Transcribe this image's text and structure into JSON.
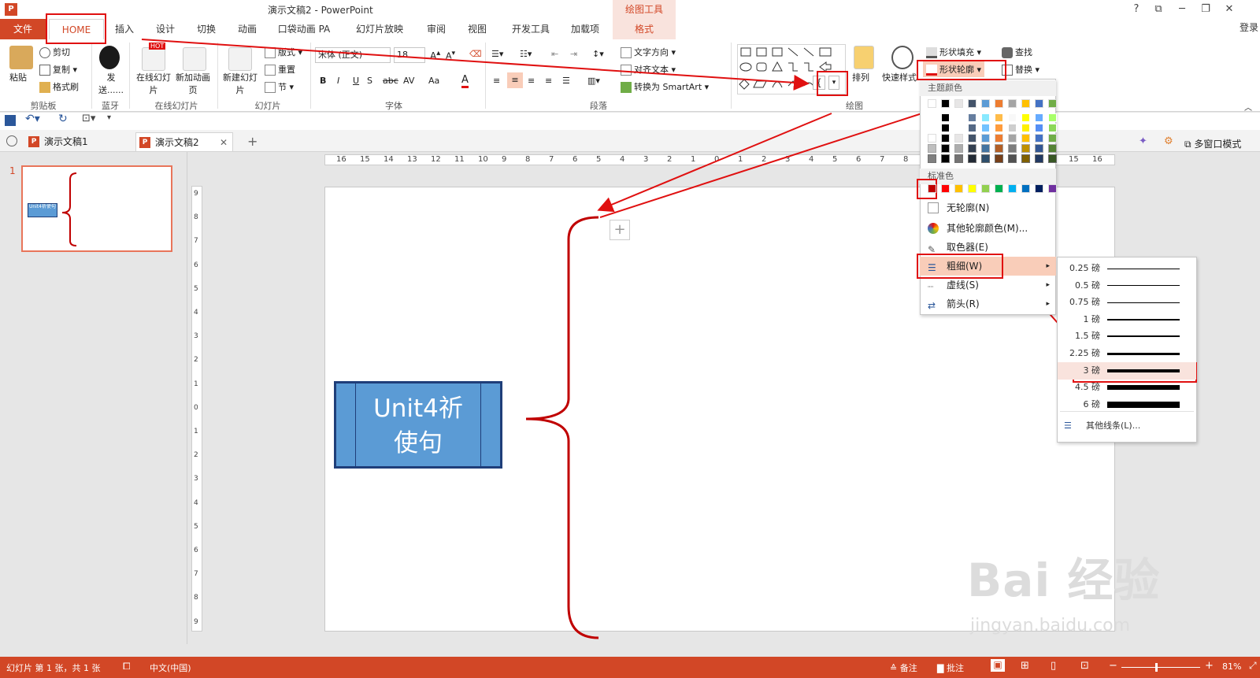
{
  "window": {
    "title": "演示文稿2 - PowerPoint",
    "context_tools_label": "绘图工具",
    "help": "?",
    "ribbon_opts": "⧉",
    "minimize": "─",
    "restore": "❐",
    "close": "✕",
    "signin": "登录"
  },
  "tabs": [
    "文件",
    "HOME",
    "插入",
    "设计",
    "切换",
    "动画",
    "口袋动画 PA",
    "幻灯片放映",
    "审阅",
    "视图",
    "开发工具",
    "加载项",
    "格式"
  ],
  "ribbon": {
    "clipboard": {
      "paste": "粘贴",
      "cut": "剪切",
      "copy": "复制",
      "format_painter": "格式刷",
      "label": "剪贴板"
    },
    "bluetooth": {
      "send": "发送......",
      "label": "蓝牙"
    },
    "online_slides": {
      "online": "在线幻灯片",
      "add_anim": "新加动画页",
      "hot": "HOT",
      "label": "在线幻灯片"
    },
    "slides": {
      "new_slide": "新建幻灯片",
      "layout": "版式",
      "reset": "重置",
      "section": "节",
      "label": "幻灯片"
    },
    "font": {
      "font_name": "宋体 (正文)",
      "font_size": "18",
      "bold": "B",
      "italic": "I",
      "underline": "U",
      "strike": "abc",
      "spacing": "AV",
      "case": "Aa",
      "color": "A",
      "label": "字体"
    },
    "paragraph": {
      "text_direction": "文字方向",
      "align_text": "对齐文本",
      "smartart": "转换为 SmartArt",
      "label": "段落"
    },
    "drawing": {
      "arrange": "排列",
      "quick_styles": "快速样式",
      "shape_fill": "形状填充",
      "shape_outline": "形状轮廓",
      "label": "绘图"
    },
    "editing": {
      "find": "查找",
      "replace": "替换"
    }
  },
  "doc_tabs": [
    "演示文稿1",
    "演示文稿2"
  ],
  "slide_panel": {
    "slide_number": "1",
    "thumb_text": "Unit4祈使句"
  },
  "hruler_ticks": [
    "16",
    "15",
    "14",
    "13",
    "12",
    "11",
    "10",
    "9",
    "8",
    "7",
    "6",
    "5",
    "4",
    "3",
    "2",
    "1",
    "0",
    "1",
    "2",
    "3",
    "4",
    "5",
    "6",
    "7",
    "8",
    "9",
    "10",
    "11",
    "12",
    "13",
    "14",
    "15",
    "16"
  ],
  "vruler_ticks": [
    "9",
    "8",
    "7",
    "6",
    "5",
    "4",
    "3",
    "2",
    "1",
    "0",
    "1",
    "2",
    "3",
    "4",
    "5",
    "6",
    "7",
    "8",
    "9"
  ],
  "slide": {
    "box_text_line1": "Unit4祈",
    "box_text_line2": "使句"
  },
  "outline_menu": {
    "theme_colors_label": "主题颜色",
    "standard_colors_label": "标准色",
    "no_outline": "无轮廓(N)",
    "more_colors": "其他轮廓颜色(M)...",
    "eyedropper": "取色器(E)",
    "weight": "粗细(W)",
    "dashes": "虚线(S)",
    "arrows": "箭头(R)",
    "theme_colors": [
      "#ffffff",
      "#000000",
      "#e7e6e6",
      "#44546a",
      "#5b9bd5",
      "#ed7d31",
      "#a5a5a5",
      "#ffc000",
      "#4472c4",
      "#70ad47"
    ],
    "standard_colors": [
      "#c00000",
      "#ff0000",
      "#ffc000",
      "#ffff00",
      "#92d050",
      "#00b050",
      "#00b0f0",
      "#0070c0",
      "#002060",
      "#7030a0"
    ]
  },
  "weight_menu": {
    "options": [
      "0.25 磅",
      "0.5 磅",
      "0.75 磅",
      "1 磅",
      "1.5 磅",
      "2.25 磅",
      "3 磅",
      "4.5 磅",
      "6 磅"
    ],
    "more_lines": "其他线条(L)..."
  },
  "status": {
    "slide_info": "幻灯片 第 1 张，共 1 张",
    "language": "中文(中国)",
    "notes": "备注",
    "comments": "批注",
    "zoom": "81%",
    "multi_window": "多窗口模式"
  },
  "watermark": {
    "text": "Bai 经验",
    "url": "jingyan.baidu.com"
  },
  "colors": {
    "accent": "#d24726",
    "shape_fill": "#5b9bd5",
    "annotation_red": "#e01010"
  }
}
